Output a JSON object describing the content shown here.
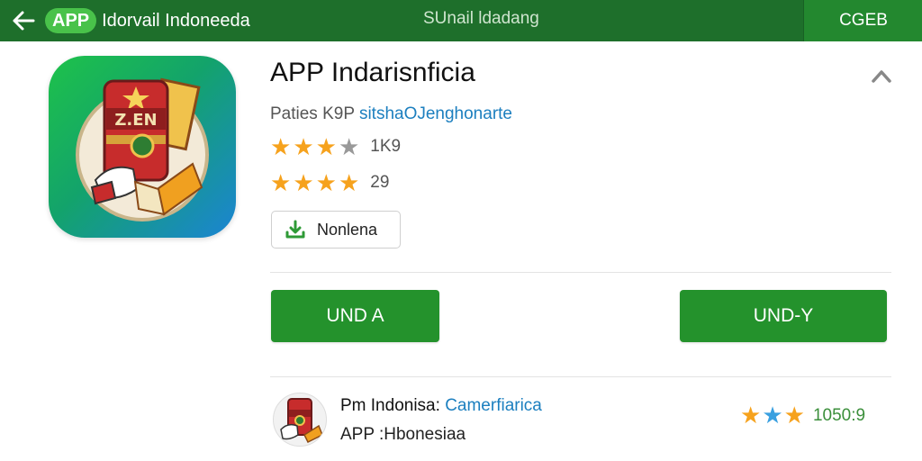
{
  "topbar": {
    "back_icon": "arrow-left-icon",
    "brand_pill": "APP",
    "brand_text": "Idorvail Indoneeda",
    "center_text": "SUnail ldadang",
    "right_button": "CGEB",
    "color": "#1e6f2b"
  },
  "app": {
    "icon": "app-icon",
    "title": "APP Indarisnficia",
    "publisher_prefix": "Paties K9P",
    "publisher_link": "sitshaOJenghonarte",
    "rating_primary": {
      "stars": 3,
      "max": 4,
      "value": "1K9"
    },
    "rating_secondary": {
      "stars": 4,
      "max": 4,
      "value": "29"
    },
    "install_small_label": "Nonlena",
    "download_icon": "download-icon",
    "collapse_icon": "chevron-up-icon"
  },
  "actions": {
    "primary_label": "UND A",
    "secondary_label": "UND-Y"
  },
  "related": {
    "title": "Pm Indonisa:",
    "category": "Camerfiarica",
    "subtitle": "APP :Hbonesiaa",
    "rating_value": "1050:9",
    "star_count": 3
  },
  "colors": {
    "accent_green": "#24922c",
    "star": "#f6a21d",
    "link": "#1c7fbf"
  }
}
